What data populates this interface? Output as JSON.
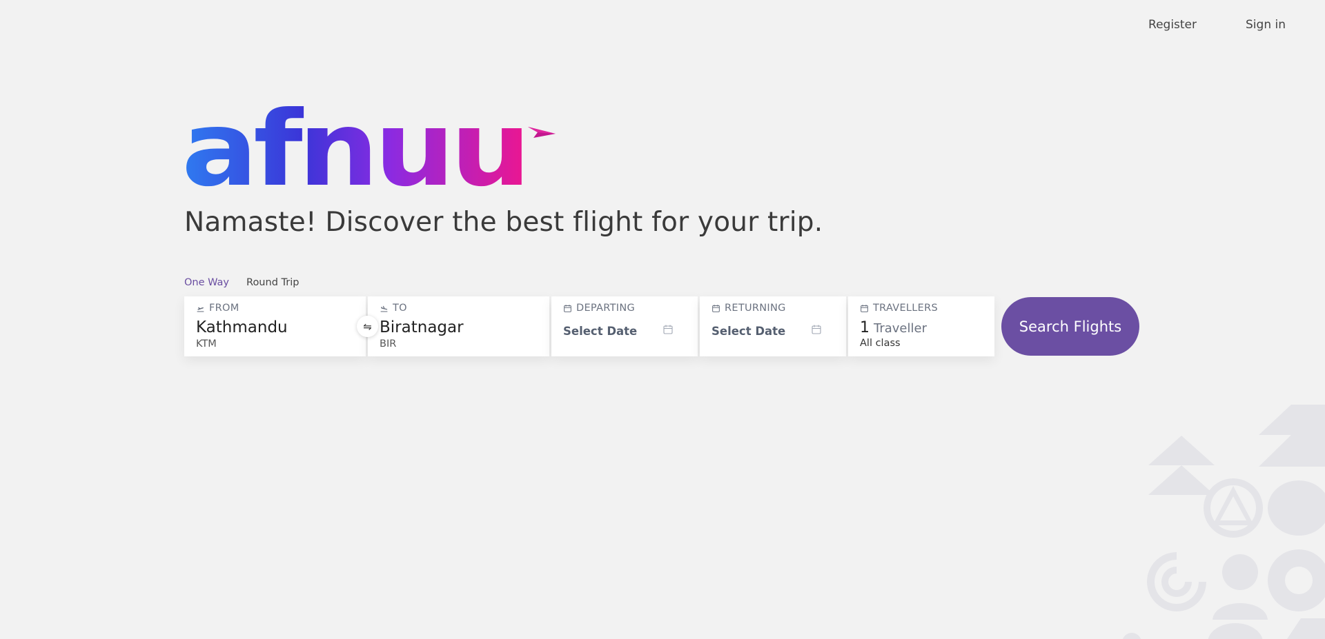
{
  "nav": {
    "register": "Register",
    "signin": "Sign in"
  },
  "brand": {
    "logo_text": "afnuu",
    "colors": [
      "#2f6fe8",
      "#3b35d8",
      "#8a2be2",
      "#c21fa8",
      "#e6168f"
    ]
  },
  "hero": {
    "headline": "Namaste! Discover the best flight for your trip."
  },
  "trip_types": {
    "one_way": "One Way",
    "round_trip": "Round Trip",
    "selected": "One Way"
  },
  "search": {
    "from": {
      "label": "FROM",
      "city": "Kathmandu",
      "code": "KTM",
      "icon": "takeoff-icon"
    },
    "swap_icon": "swap-icon",
    "to": {
      "label": "TO",
      "city": "Biratnagar",
      "code": "BIR",
      "icon": "landing-icon"
    },
    "departing": {
      "label": "DEPARTING",
      "value": "Select Date",
      "icon": "calendar-icon"
    },
    "returning": {
      "label": "RETURNING",
      "value": "Select Date",
      "icon": "calendar-icon"
    },
    "travellers": {
      "label": "TRAVELLERS",
      "count": "1",
      "unit": "Traveller",
      "class": "All class",
      "icon": "calendar-icon"
    },
    "button": "Search Flights",
    "accent": "#6b4fa3"
  }
}
